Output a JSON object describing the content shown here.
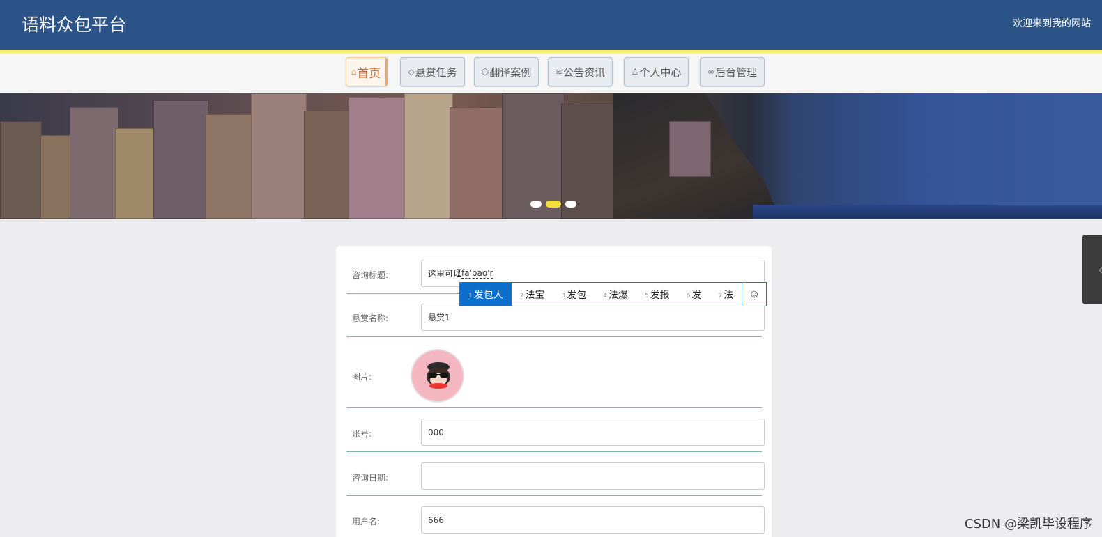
{
  "header": {
    "site_title": "语料众包平台",
    "welcome": "欢迎来到我的网站"
  },
  "nav": {
    "items": [
      {
        "icon": "home-icon",
        "glyph": "⌂",
        "label": "首页",
        "active": true
      },
      {
        "icon": "tag-icon",
        "glyph": "◇",
        "label": "悬赏任务",
        "active": false
      },
      {
        "icon": "cube-icon",
        "glyph": "⬡",
        "label": "翻译案例",
        "active": false
      },
      {
        "icon": "layers-icon",
        "glyph": "≋",
        "label": "公告资讯",
        "active": false
      },
      {
        "icon": "user-icon",
        "glyph": "♙",
        "label": "个人中心",
        "active": false
      },
      {
        "icon": "link-icon",
        "glyph": "∞",
        "label": "后台管理",
        "active": false
      }
    ]
  },
  "banner": {
    "slides": 3,
    "active_slide": 2
  },
  "form": {
    "title_label": "咨询标题:",
    "title_value": "这里可以",
    "title_composing": "fa'bao'r",
    "reward_label": "悬赏名称:",
    "reward_value": "悬赏1",
    "image_label": "图片:",
    "account_label": "账号:",
    "account_value": "000",
    "date_label": "咨询日期:",
    "date_value": "",
    "username_label": "用户名:",
    "username_value": "666"
  },
  "ime": {
    "candidates": [
      {
        "n": "1",
        "text": "发包人"
      },
      {
        "n": "2",
        "text": "法宝"
      },
      {
        "n": "3",
        "text": "发包"
      },
      {
        "n": "4",
        "text": "法爆"
      },
      {
        "n": "5",
        "text": "发报"
      },
      {
        "n": "6",
        "text": "发"
      },
      {
        "n": "7",
        "text": "法"
      }
    ],
    "emoji_icon": "smiley-icon",
    "emoji_glyph": "☺"
  },
  "watermark": "CSDN @梁凯毕设程序",
  "colors": {
    "header_bg": "#2d5488",
    "accent_yellow": "#f4ec4e",
    "ime_selected": "#0b6fcb"
  }
}
